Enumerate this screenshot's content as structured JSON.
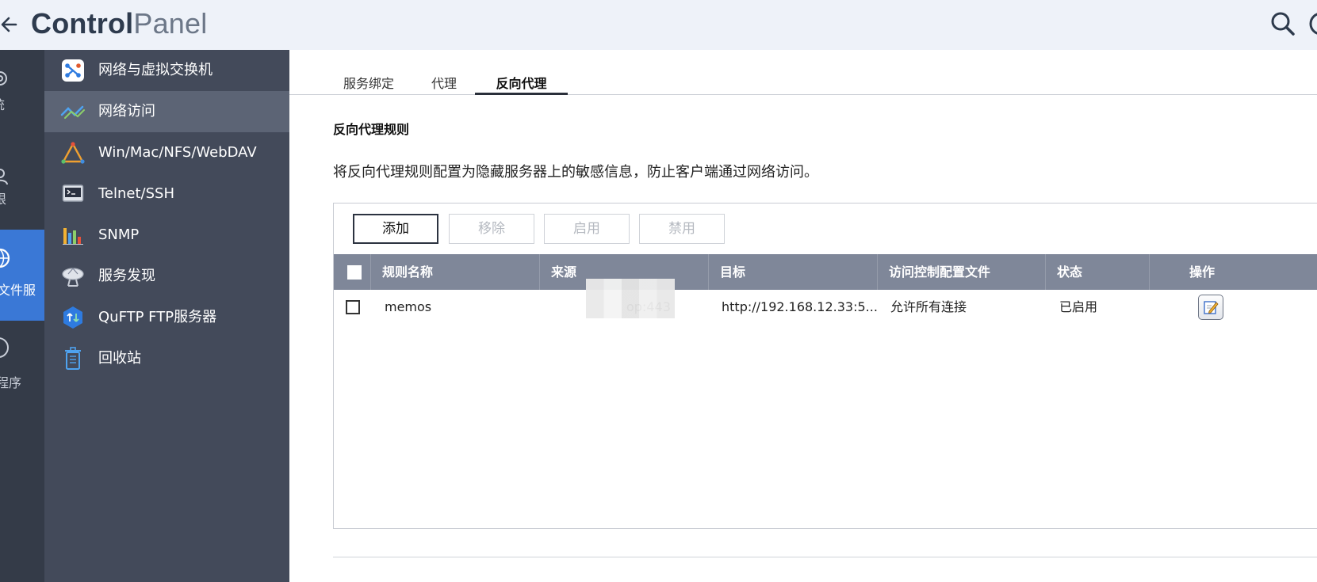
{
  "header": {
    "title_bold": "Control",
    "title_light": "Panel",
    "back_icon": "arrow-left-icon",
    "search_icon": "search-icon"
  },
  "rail": {
    "items": [
      {
        "label": "统",
        "icon": "gear-icon"
      },
      {
        "label": "限",
        "icon": "user-icon"
      },
      {
        "label": "文件服",
        "icon": "globe-icon",
        "active": true
      },
      {
        "label": "程序",
        "icon": "info-icon"
      }
    ]
  },
  "sidebar": {
    "items": [
      {
        "label": "网络与虚拟交换机",
        "icon": "network-switch-icon"
      },
      {
        "label": "网络访问",
        "icon": "network-access-icon",
        "active": true
      },
      {
        "label": "Win/Mac/NFS/WebDAV",
        "icon": "file-sharing-icon"
      },
      {
        "label": "Telnet/SSH",
        "icon": "terminal-icon"
      },
      {
        "label": "SNMP",
        "icon": "bar-chart-icon"
      },
      {
        "label": "服务发现",
        "icon": "satellite-dish-icon"
      },
      {
        "label": "QuFTP FTP服务器",
        "icon": "ftp-icon"
      },
      {
        "label": "回收站",
        "icon": "recycle-bin-icon"
      }
    ]
  },
  "tabs": [
    {
      "label": "服务绑定"
    },
    {
      "label": "代理"
    },
    {
      "label": "反向代理",
      "active": true
    }
  ],
  "section": {
    "title": "反向代理规则",
    "description": "将反向代理规则配置为隐藏服务器上的敏感信息，防止客户端通过网络访问。"
  },
  "toolbar": {
    "add": "添加",
    "remove": "移除",
    "enable": "启用",
    "disable": "禁用"
  },
  "table": {
    "headers": [
      "规则名称",
      "来源",
      "目标",
      "访问控制配置文件",
      "状态",
      "操作"
    ],
    "rows": [
      {
        "name": "memos",
        "source": "op:443",
        "target": "http://192.168.12.33:5...",
        "acl": "允许所有连接",
        "status": "已启用",
        "action_icon": "edit-icon"
      }
    ]
  },
  "colors": {
    "header_bg": "#eef2f9",
    "rail_bg": "#343b48",
    "rail_active": "#3a78d6",
    "sidebar_bg": "#434a5a",
    "sidebar_active": "#5c6475",
    "table_header_bg": "#7f8799"
  }
}
